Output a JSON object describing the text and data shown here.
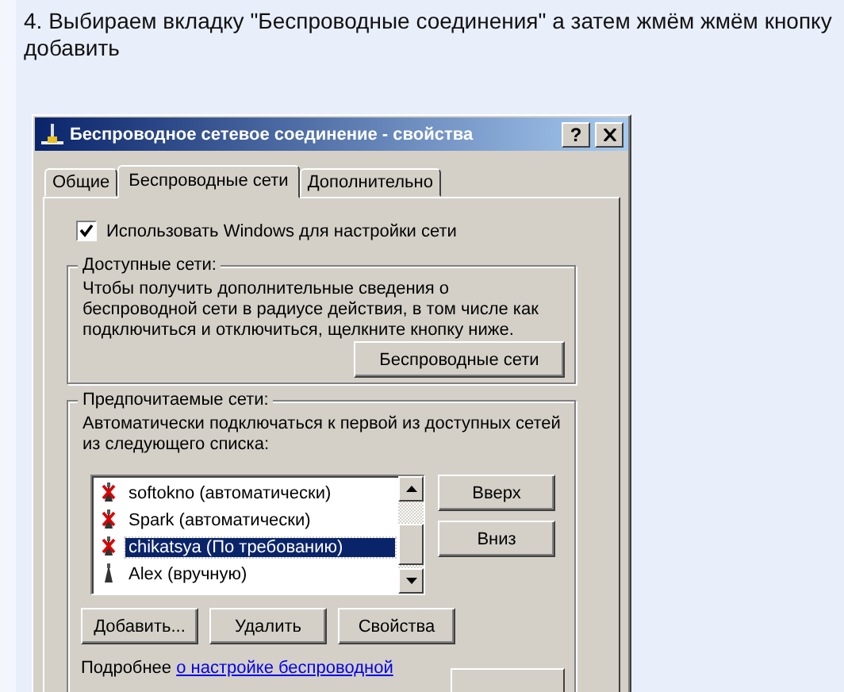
{
  "instruction": {
    "text": "4. Выбираем вкладку \"Беспроводные соединения\" а затем жмём жмём кнопку добавить"
  },
  "dialog": {
    "title": "Беспроводное сетевое соединение - свойства",
    "help_button": "?"
  },
  "tabs": [
    {
      "label": "Общие",
      "selected": false
    },
    {
      "label": "Беспроводные сети",
      "selected": true
    },
    {
      "label": "Дополнительно",
      "selected": false
    }
  ],
  "use_windows": {
    "label": "Использовать Windows для настройки сети",
    "checked": true
  },
  "available_networks": {
    "title": "Доступные сети:",
    "description": "Чтобы получить дополнительные сведения о беспроводной сети в радиусе действия, в том числе как подключиться и отключиться, щелкните кнопку ниже.",
    "button": "Беспроводные сети"
  },
  "preferred_networks": {
    "title": "Предпочитаемые сети:",
    "description": "Автоматически подключаться к первой из доступных сетей из следующего списка:",
    "networks": [
      {
        "name": "softokno (автоматически)",
        "kind": "crossed",
        "selected": false
      },
      {
        "name": "Spark (автоматически)",
        "kind": "crossed",
        "selected": false
      },
      {
        "name": "chikatsya (По требованию)",
        "kind": "crossed",
        "selected": true
      },
      {
        "name": "Alex (вручную)",
        "kind": "plain",
        "selected": false
      }
    ],
    "move_buttons": [
      "Вверх",
      "Вниз"
    ],
    "buttons": [
      "Добавить...",
      "Удалить",
      "Свойства"
    ]
  },
  "footer": {
    "text": "Подробнее",
    "link": "о настройке беспроводной"
  }
}
